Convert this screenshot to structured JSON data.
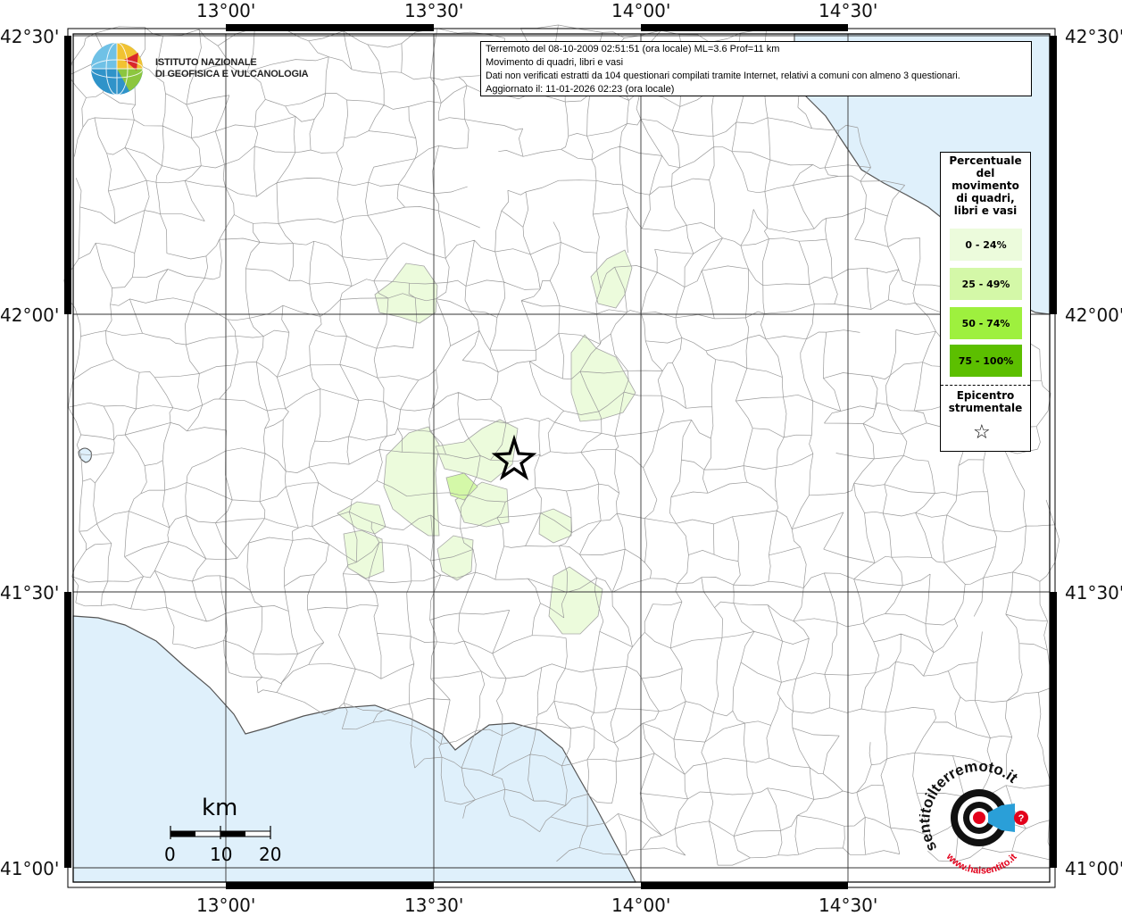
{
  "map": {
    "lat_labels": [
      "42°30'",
      "42°00'",
      "41°30'",
      "41°00'"
    ],
    "lon_labels": [
      "13°00'",
      "13°30'",
      "14°00'",
      "14°30'"
    ]
  },
  "logo": {
    "line1": "Istituto Nazionale",
    "line2": "di Geofisica e Vulcanologia"
  },
  "info": {
    "line1": "Terremoto del 08-10-2009 02:51:51 (ora locale) ML=3.6 Prof=11 km",
    "line2": "Movimento di quadri, libri e vasi",
    "line3": "Dati non verificati estratti da 104 questionari compilati tramite Internet, relativi a comuni con almeno 3 questionari.",
    "line4": "Aggiornato il: 11-01-2026 02:23 (ora locale)"
  },
  "legend": {
    "title_lines": [
      "Percentuale",
      "del",
      "movimento",
      "di quadri,",
      "libri e vasi"
    ],
    "classes": [
      {
        "label": "0 - 24%",
        "color": "#ecfbdc"
      },
      {
        "label": "25 - 49%",
        "color": "#d4f8a8"
      },
      {
        "label": "50 - 74%",
        "color": "#9ef03e"
      },
      {
        "label": "75 - 100%",
        "color": "#5cbf00"
      }
    ],
    "epicenter_lines": [
      "Epicentro",
      "strumentale"
    ],
    "epicenter_symbol": "☆"
  },
  "scale": {
    "unit": "km",
    "ticks": [
      "0",
      "10",
      "20"
    ]
  },
  "seal": {
    "text_top": "sentitoilterremoto.it",
    "text_bottom": "www.haisentito.it"
  },
  "colors": {
    "sea": "#dff0fb",
    "highlight_light": "#ecfbdc",
    "highlight_mid": "#d4f8a8",
    "boundary": "#9a9a9a",
    "grid": "#333333"
  }
}
